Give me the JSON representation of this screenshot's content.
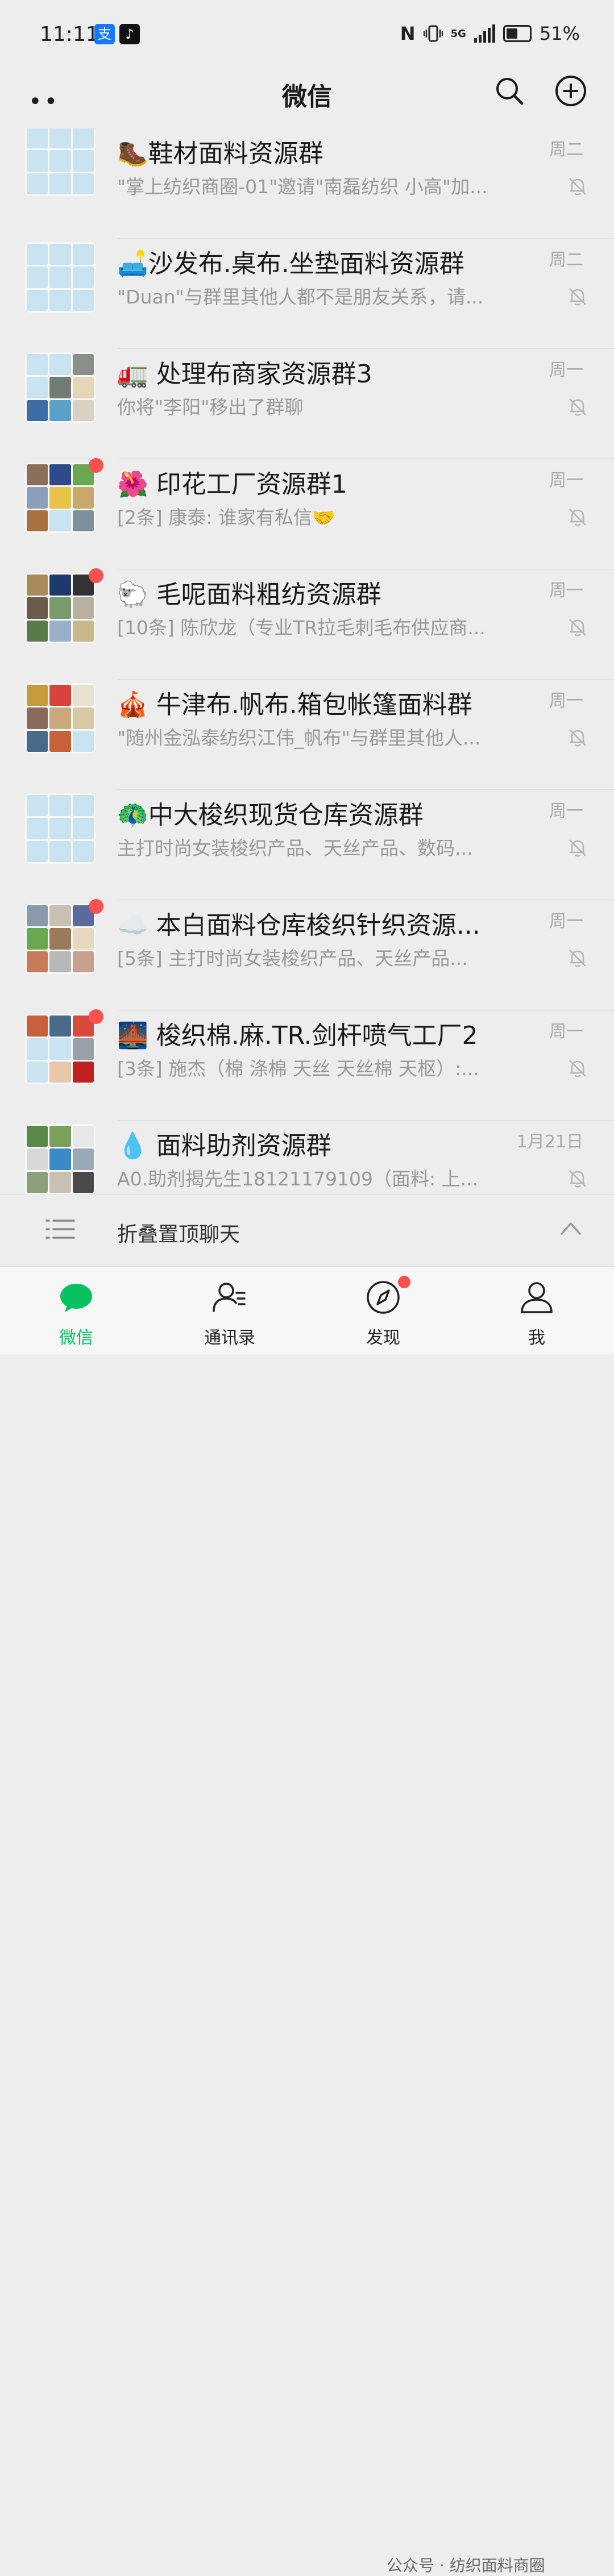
{
  "status_bar": {
    "time": "11:11",
    "alipay_icon_text": "支",
    "tiktok_icon_text": "♪",
    "nfc": "N",
    "network": "5G",
    "battery": "51%",
    "battery_level": 0.51
  },
  "header": {
    "title": "微信",
    "more": "••",
    "search_icon": "search-icon",
    "add_icon": "plus-circle-icon"
  },
  "chats": [
    {
      "name": "🥾鞋材面料资源群",
      "preview": "\"掌上纺织商圈-01\"邀请\"南磊纺织 小高\"加...",
      "time": "周二",
      "unread": false,
      "avatar": [
        "#c9e4f0",
        "#c9e4f0",
        "#c9e4f0",
        "#c9e4f0",
        "#c9e4f0",
        "#c9e4f0",
        "#c9e4f0",
        "#c9e4f0",
        "#c9e4f0"
      ]
    },
    {
      "name": "🛋️沙发布.桌布.坐垫面料资源群",
      "preview": "\"Duan\"与群里其他人都不是朋友关系，请...",
      "time": "周二",
      "unread": false,
      "avatar": [
        "#c9e4f0",
        "#c9e4f0",
        "#c9e4f0",
        "#c9e4f0",
        "#c9e4f0",
        "#c9e4f0",
        "#c9e4f0",
        "#c9e4f0",
        "#c9e4f0"
      ]
    },
    {
      "name": "🚛 处理布商家资源群3",
      "preview": "你将\"李阳\"移出了群聊",
      "time": "周一",
      "unread": false,
      "avatar": [
        "#c9e4f0",
        "#c9e4f0",
        "#8a8f8a",
        "#c9e4f0",
        "#6f7d74",
        "#e6d6b8",
        "#3b6ea8",
        "#5aa0c8",
        "#d9d2c4"
      ]
    },
    {
      "name": "🌺 印花工厂资源群1",
      "preview": "[2条] 康泰: 谁家有私信🤝",
      "time": "周一",
      "unread": true,
      "avatar": [
        "#8a6f5a",
        "#2f4a8a",
        "#6aa84f",
        "#8aa0b8",
        "#e8c24a",
        "#c9a86b",
        "#a9713f",
        "#c9e4f0",
        "#7d8f9a"
      ]
    },
    {
      "name": "🐑 毛呢面料粗纺资源群",
      "preview": "[10条] 陈欣龙（专业TR拉毛刺毛布供应商...",
      "time": "周一",
      "unread": true,
      "avatar": [
        "#a98a5a",
        "#1e3a6b",
        "#333333",
        "#6c5a4a",
        "#7a9a6a",
        "#b8b0a0",
        "#5a7a4a",
        "#9ab0c8",
        "#c8b88a"
      ]
    },
    {
      "name": "🎪 牛津布.帆布.箱包帐篷面料群",
      "preview": "\"随州金泓泰纺织江伟_帆布\"与群里其他人...",
      "time": "周一",
      "unread": false,
      "avatar": [
        "#c89a3a",
        "#d9443a",
        "#e8e0d0",
        "#8a6a5a",
        "#c9a87a",
        "#d8c8a8",
        "#4a6a8a",
        "#c8603a",
        "#c9e4f0"
      ]
    },
    {
      "name": "🦚中大梭织现货仓库资源群",
      "preview": "主打时尚女装梭织产品、天丝产品、数码...",
      "time": "周一",
      "unread": false,
      "avatar": [
        "#c9e4f0",
        "#c9e4f0",
        "#c9e4f0",
        "#c9e4f0",
        "#c9e4f0",
        "#c9e4f0",
        "#c9e4f0",
        "#c9e4f0",
        "#c9e4f0"
      ]
    },
    {
      "name": "☁️ 本白面料仓库梭织针织资源...",
      "preview": "[5条] 主打时尚女装梭织产品、天丝产品...",
      "time": "周一",
      "unread": true,
      "avatar": [
        "#8a9aaa",
        "#c8c0b0",
        "#5a6a9a",
        "#6aa84f",
        "#9a7a5a",
        "#e8d8c0",
        "#c87a5a",
        "#b8b8b8",
        "#c9a090"
      ]
    },
    {
      "name": "🌉 梭织棉.麻.TR.剑杆喷气工厂2",
      "preview": "[3条] 施杰（棉 涤棉 天丝 天丝棉 天枢）:...",
      "time": "周一",
      "unread": true,
      "avatar": [
        "#c8603a",
        "#4a6a8a",
        "#d84a3a",
        "#c9e4f0",
        "#c9e4f0",
        "#9aa0a8",
        "#c9e4f0",
        "#e8c8a8",
        "#c02020"
      ]
    },
    {
      "name": "💧 面料助剂资源群",
      "preview": "A0.助剂揭先生18121179109（面料: 上...",
      "time": "1月21日",
      "unread": false,
      "avatar": [
        "#5a8a4a",
        "#7aa05a",
        "#e8e8e8",
        "#d8d8d8",
        "#3a8ac8",
        "#9aa8b8",
        "#8aa07a",
        "#c8c0b0",
        "#4a4a4a"
      ]
    }
  ],
  "fold": {
    "label": "折叠置顶聊天",
    "menu_icon": "list-icon",
    "chevron_icon": "chevron-up-icon"
  },
  "tabs": [
    {
      "label": "微信",
      "icon": "chat-bubble-icon",
      "active": true
    },
    {
      "label": "通讯录",
      "icon": "contacts-icon",
      "active": false
    },
    {
      "label": "发现",
      "icon": "compass-icon",
      "active": false,
      "badge": true
    },
    {
      "label": "我",
      "icon": "person-icon",
      "active": false
    }
  ],
  "watermark": "公众号 · 纺织面料商圈",
  "colors": {
    "accent": "#07c160",
    "badge": "#fa5151",
    "background": "#ededed"
  }
}
